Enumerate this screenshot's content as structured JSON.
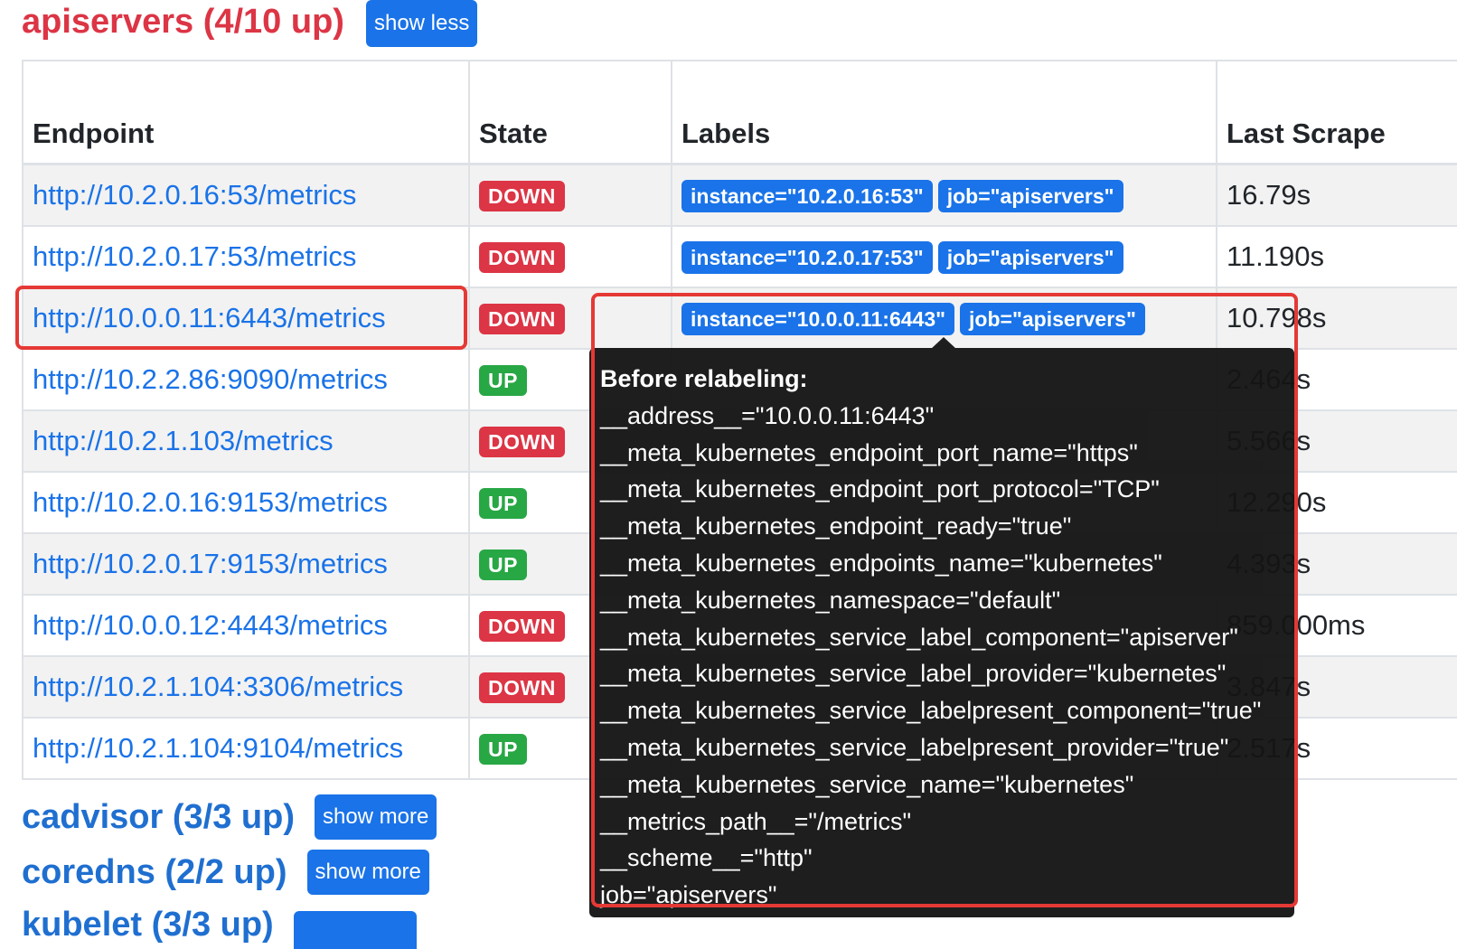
{
  "apiservers": {
    "title": "apiservers (4/10 up)",
    "toggle_label": "show less"
  },
  "table": {
    "headers": {
      "endpoint": "Endpoint",
      "state": "State",
      "labels": "Labels",
      "last_scrape": "Last Scrape"
    },
    "rows": [
      {
        "endpoint": "http://10.2.0.16:53/metrics",
        "state": "DOWN",
        "instance": "instance=\"10.2.0.16:53\"",
        "job": "job=\"apiservers\"",
        "last_scrape": "16.79s"
      },
      {
        "endpoint": "http://10.2.0.17:53/metrics",
        "state": "DOWN",
        "instance": "instance=\"10.2.0.17:53\"",
        "job": "job=\"apiservers\"",
        "last_scrape": "11.190s"
      },
      {
        "endpoint": "http://10.0.0.11:6443/metrics",
        "state": "DOWN",
        "instance": "instance=\"10.0.0.11:6443\"",
        "job": "job=\"apiservers\"",
        "last_scrape": "10.798s"
      },
      {
        "endpoint": "http://10.2.2.86:9090/metrics",
        "state": "UP",
        "last_scrape": "2.464s"
      },
      {
        "endpoint": "http://10.2.1.103/metrics",
        "state": "DOWN",
        "last_scrape": "5.566s"
      },
      {
        "endpoint": "http://10.2.0.16:9153/metrics",
        "state": "UP",
        "last_scrape": "12.290s"
      },
      {
        "endpoint": "http://10.2.0.17:9153/metrics",
        "state": "UP",
        "last_scrape": "4.393s"
      },
      {
        "endpoint": "http://10.0.0.12:4443/metrics",
        "state": "DOWN",
        "last_scrape": "859.000ms"
      },
      {
        "endpoint": "http://10.2.1.104:3306/metrics",
        "state": "DOWN",
        "last_scrape": "3.847s"
      },
      {
        "endpoint": "http://10.2.1.104:9104/metrics",
        "state": "UP",
        "last_scrape": "2.517s"
      }
    ]
  },
  "cadvisor": {
    "title": "cadvisor (3/3 up)",
    "toggle_label": "show more"
  },
  "coredns": {
    "title": "coredns (2/2 up)",
    "toggle_label": "show more"
  },
  "kubelet": {
    "title": "kubelet (3/3 up)"
  },
  "tooltip": {
    "title": "Before relabeling:",
    "lines": [
      "__address__=\"10.0.0.11:6443\"",
      "__meta_kubernetes_endpoint_port_name=\"https\"",
      "__meta_kubernetes_endpoint_port_protocol=\"TCP\"",
      "__meta_kubernetes_endpoint_ready=\"true\"",
      "__meta_kubernetes_endpoints_name=\"kubernetes\"",
      "__meta_kubernetes_namespace=\"default\"",
      "__meta_kubernetes_service_label_component=\"apiserver\"",
      "__meta_kubernetes_service_label_provider=\"kubernetes\"",
      "__meta_kubernetes_service_labelpresent_component=\"true\"",
      "__meta_kubernetes_service_labelpresent_provider=\"true\"",
      "__meta_kubernetes_service_name=\"kubernetes\"",
      "__metrics_path__=\"/metrics\"",
      "__scheme__=\"http\"",
      "job=\"apiservers\""
    ]
  },
  "colors": {
    "danger": "#dc3545",
    "success": "#28a745",
    "primary": "#1a73e8",
    "annotation_red": "#e53935",
    "tooltip_bg": "#151515"
  }
}
